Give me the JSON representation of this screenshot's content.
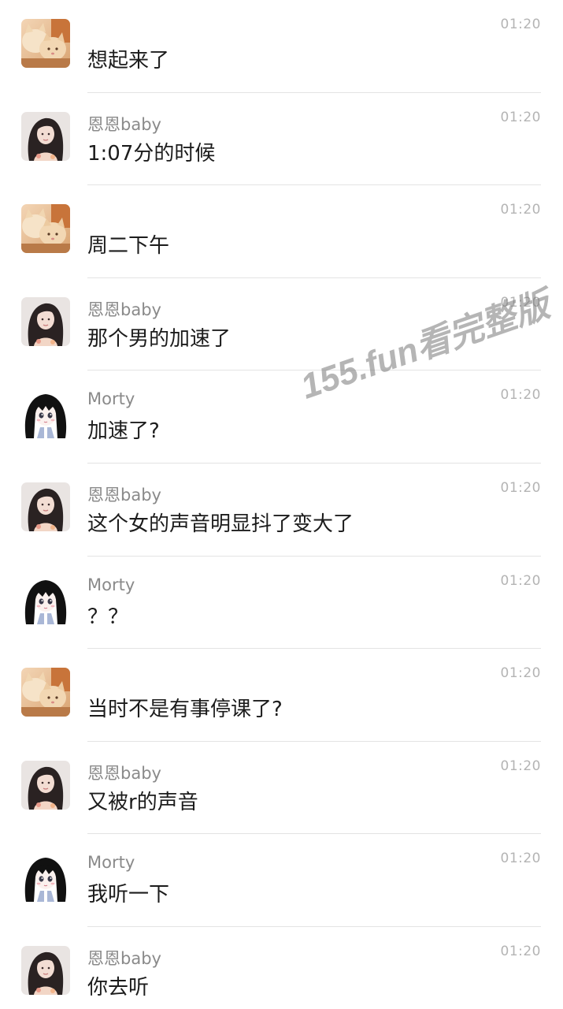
{
  "messages": [
    {
      "avatar": "cat-avatar",
      "name": "",
      "time": "01:20",
      "text": "想起来了"
    },
    {
      "avatar": "girl-photo-avatar",
      "name": "恩恩baby",
      "time": "01:20",
      "text": "1:07分的时候"
    },
    {
      "avatar": "cat-avatar",
      "name": "",
      "time": "01:20",
      "text": "周二下午"
    },
    {
      "avatar": "girl-photo-avatar",
      "name": "恩恩baby",
      "time": "01:20",
      "text": "那个男的加速了"
    },
    {
      "avatar": "anime-girl-avatar",
      "name": "Morty",
      "time": "01:20",
      "text": "加速了?"
    },
    {
      "avatar": "girl-photo-avatar",
      "name": "恩恩baby",
      "time": "01:20",
      "text": "这个女的声音明显抖了变大了"
    },
    {
      "avatar": "anime-girl-avatar",
      "name": "Morty",
      "time": "01:20",
      "text": "？？"
    },
    {
      "avatar": "cat-avatar",
      "name": "",
      "time": "01:20",
      "text": "当时不是有事停课了?"
    },
    {
      "avatar": "girl-photo-avatar",
      "name": "恩恩baby",
      "time": "01:20",
      "text": "又被r的声音"
    },
    {
      "avatar": "anime-girl-avatar",
      "name": "Morty",
      "time": "01:20",
      "text": "我听一下"
    },
    {
      "avatar": "girl-photo-avatar",
      "name": "恩恩baby",
      "time": "01:20",
      "text": "你去听"
    }
  ],
  "watermark": "155.fun看完整版",
  "colors": {
    "name": "#8a8a8a",
    "time": "#b4b4b4",
    "text": "#1c1c1c",
    "divider": "#e3e3e3"
  }
}
